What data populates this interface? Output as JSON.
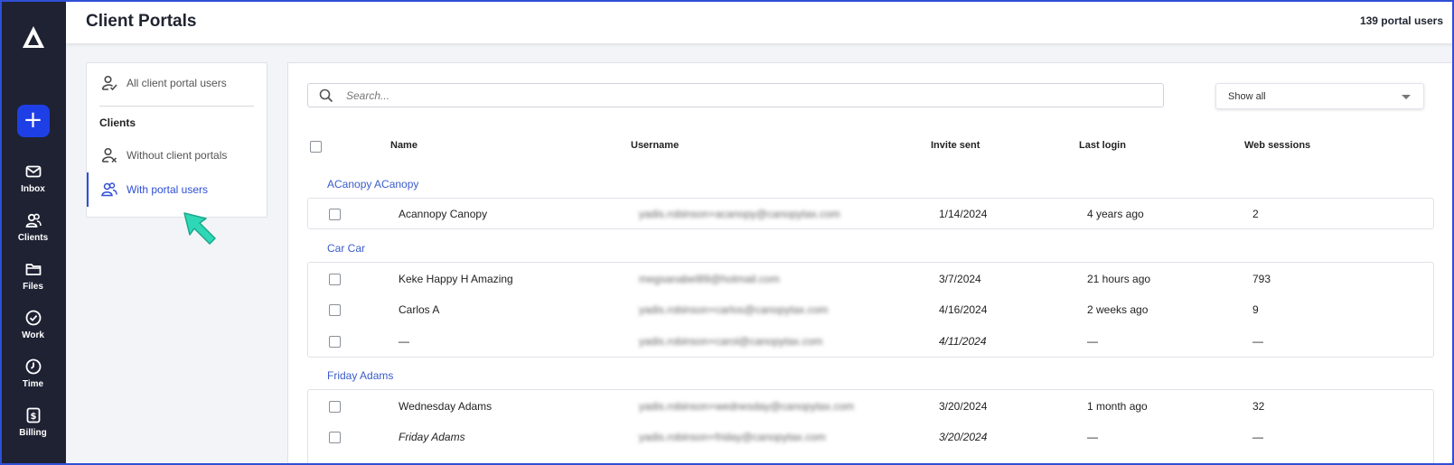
{
  "nav": {
    "add_label": "+",
    "items": [
      {
        "label": "Inbox",
        "icon": "envelope-icon"
      },
      {
        "label": "Clients",
        "icon": "clients-icon"
      },
      {
        "label": "Files",
        "icon": "folder-icon"
      },
      {
        "label": "Work",
        "icon": "check-circle-icon"
      },
      {
        "label": "Time",
        "icon": "clock-icon"
      },
      {
        "label": "Billing",
        "icon": "billing-icon"
      }
    ]
  },
  "header": {
    "title": "Client Portals",
    "portal_count": "139 portal users"
  },
  "filters": {
    "all_users": "All client portal users",
    "heading": "Clients",
    "without_portals": "Without client portals",
    "with_portal_users": "With portal users"
  },
  "toolbar": {
    "search_placeholder": "Search...",
    "show_filter": "Show all"
  },
  "table": {
    "columns": {
      "name": "Name",
      "username": "Username",
      "invite_sent": "Invite sent",
      "last_login": "Last login",
      "web_sessions": "Web sessions"
    },
    "groups": [
      {
        "label": "ACanopy ACanopy",
        "rows": [
          {
            "name": "Acannopy Canopy",
            "username": "yadis.robinson+acanopy@canopytax.com",
            "invite_sent": "1/14/2024",
            "last_login": "4 years ago",
            "web_sessions": "2"
          }
        ]
      },
      {
        "label": "Car Car",
        "rows": [
          {
            "name": "Keke Happy H Amazing",
            "username": "megsanabel89@hotmail.com",
            "invite_sent": "3/7/2024",
            "last_login": "21 hours ago",
            "web_sessions": "793"
          },
          {
            "name": "Carlos A",
            "username": "yadis.robinson+carlos@canopytax.com",
            "invite_sent": "4/16/2024",
            "last_login": "2 weeks ago",
            "web_sessions": "9"
          },
          {
            "name": "—",
            "username": "yadis.robinson+carol@canopytax.com",
            "invite_sent": "4/11/2024",
            "last_login": "—",
            "web_sessions": "—"
          }
        ]
      },
      {
        "label": "Friday Adams",
        "rows": [
          {
            "name": "Wednesday Adams",
            "username": "yadis.robinson+wednesday@canopytax.com",
            "invite_sent": "3/20/2024",
            "last_login": "1 month ago",
            "web_sessions": "32"
          },
          {
            "name": "Friday Adams",
            "username": "yadis.robinson+friday@canopytax.com",
            "invite_sent": "3/20/2024",
            "last_login": "—",
            "web_sessions": "—"
          }
        ]
      }
    ]
  },
  "colors": {
    "accent": "#1f3fe6",
    "nav_bg": "#1e2233",
    "group_link": "#3a5cc9",
    "pointer": "#2ed8b6"
  }
}
